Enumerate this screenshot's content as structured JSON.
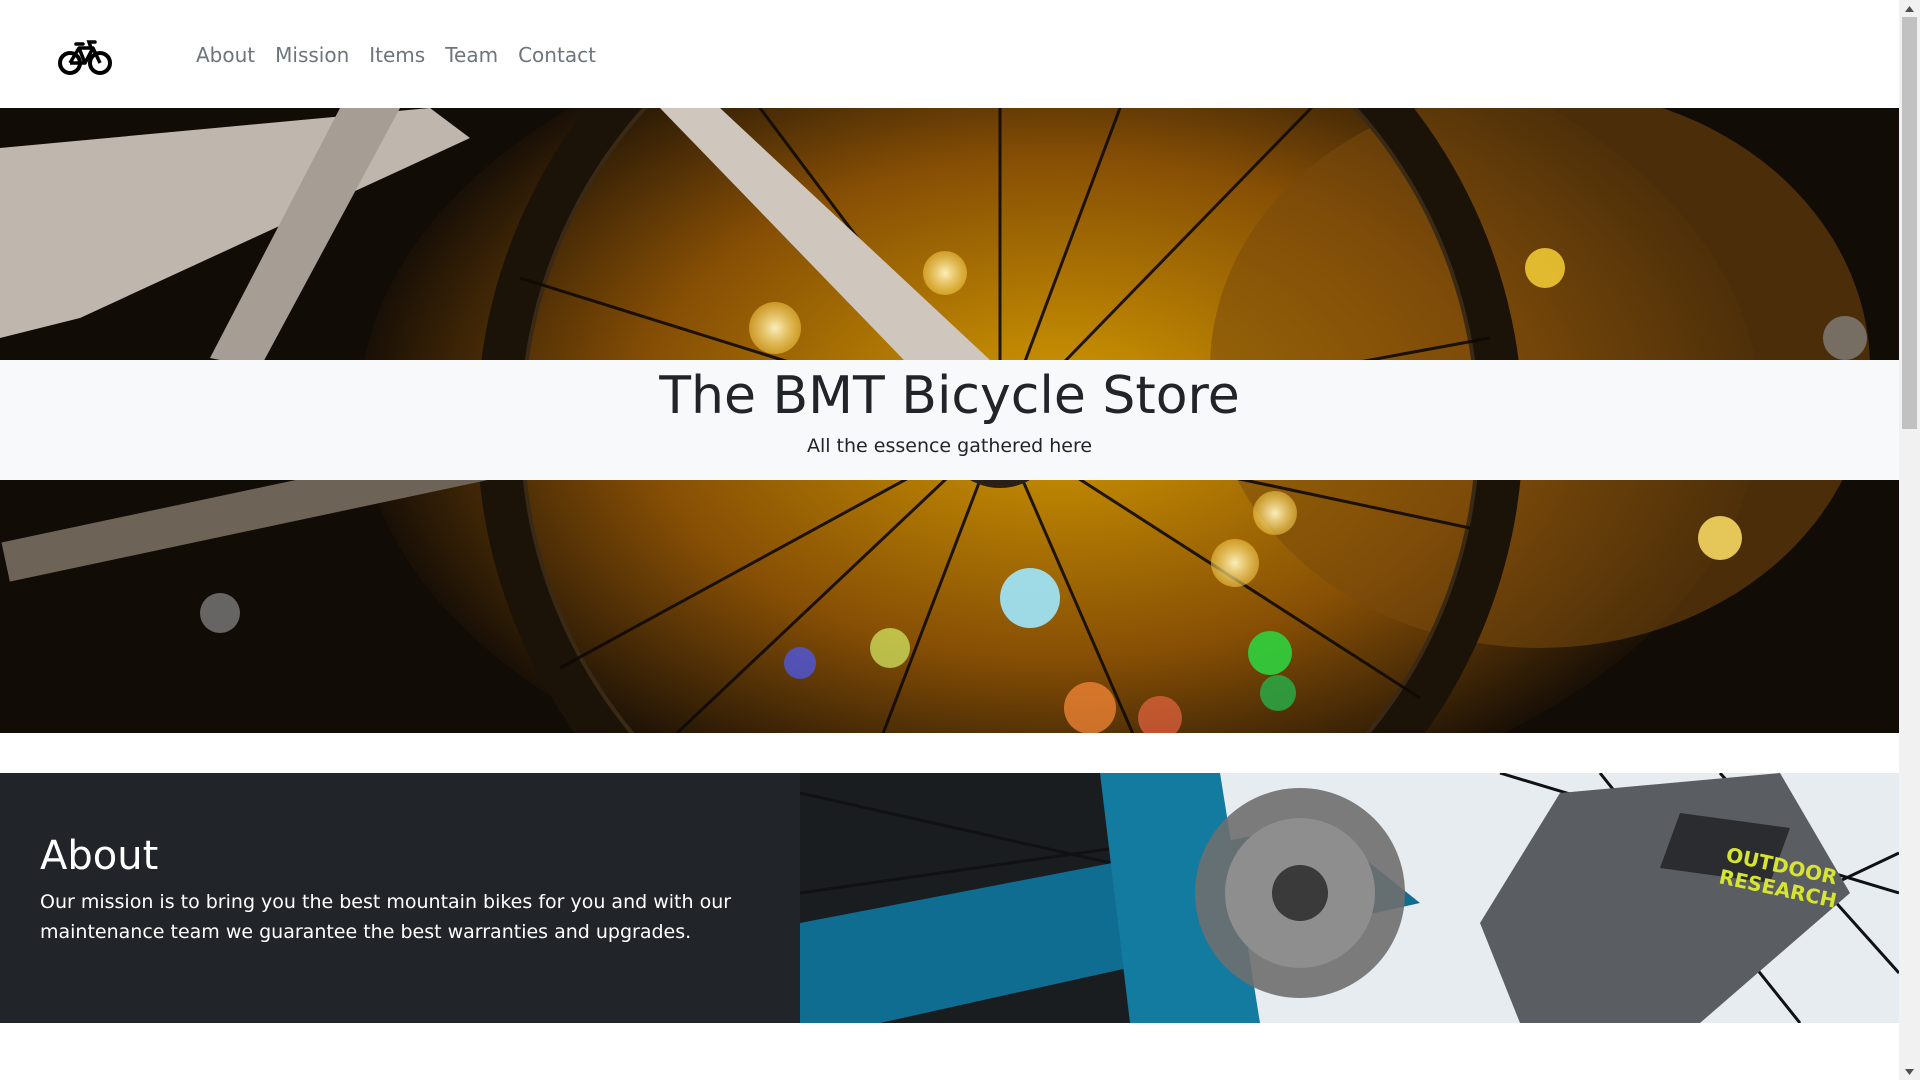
{
  "navbar": {
    "brand_icon": "bicycle-icon",
    "links": [
      {
        "label": "About"
      },
      {
        "label": "Mission"
      },
      {
        "label": "Items"
      },
      {
        "label": "Team"
      },
      {
        "label": "Contact"
      }
    ]
  },
  "hero": {
    "title": "The BMT Bicycle Store",
    "subtitle": "All the essence gathered here"
  },
  "about": {
    "heading": "About",
    "body": "Our mission is to bring you the best mountain bikes for you and with our maintenance team we guarantee the best warranties and upgrades."
  },
  "colors": {
    "nav_link": "#6c757d",
    "band_bg": "#f8f9fa",
    "about_bg": "#212529",
    "text_dark": "#212529",
    "scrollbar_thumb": "#c1c1c1"
  },
  "scrollbar": {
    "up_icon": "arrow-up-icon",
    "down_icon": "arrow-down-icon"
  }
}
